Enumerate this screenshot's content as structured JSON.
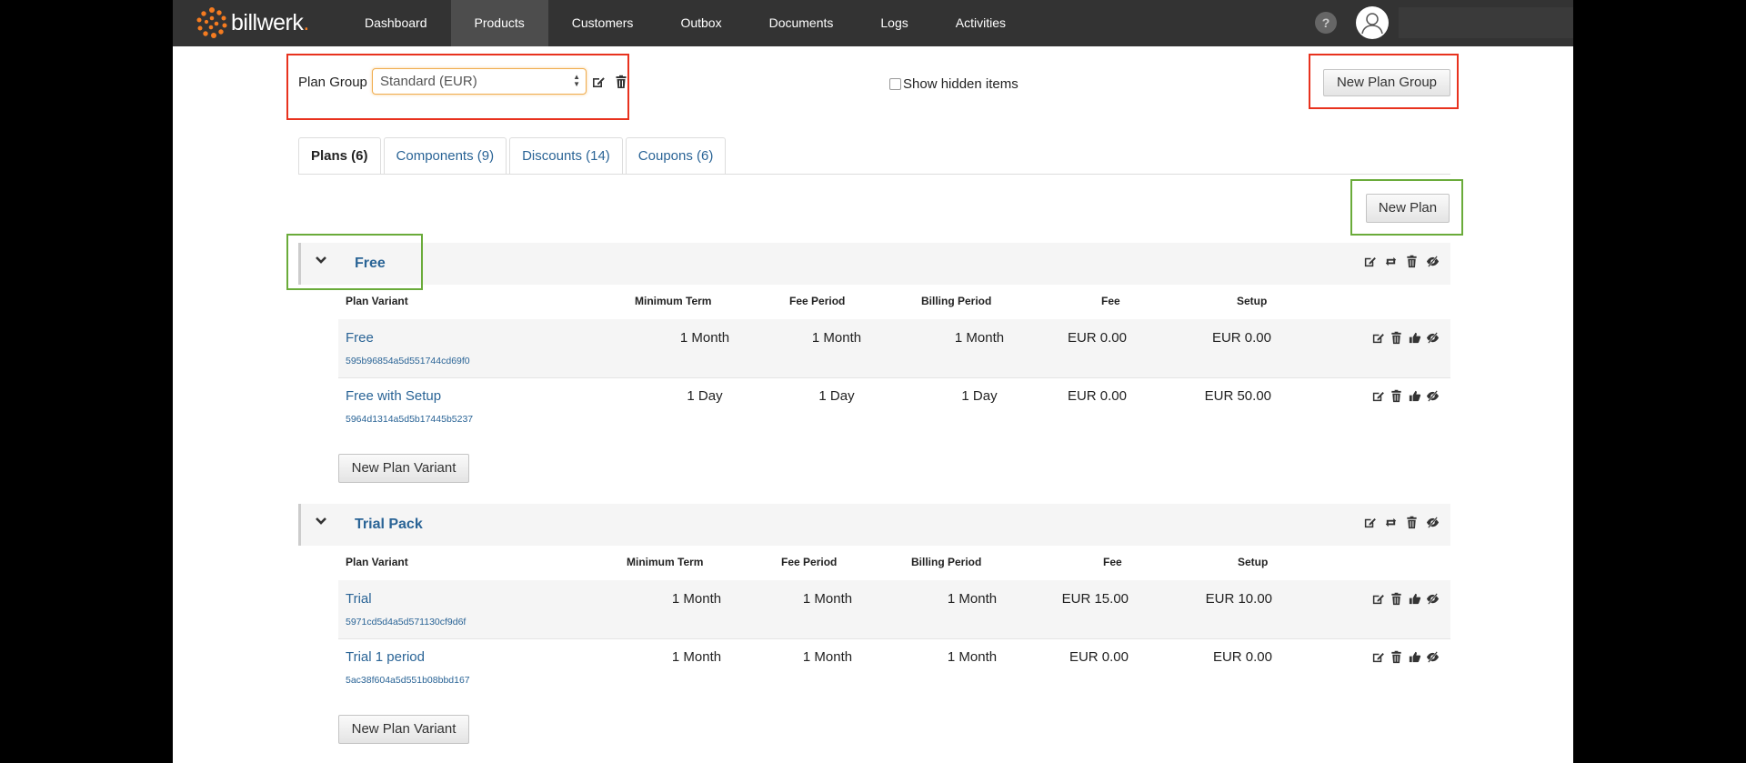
{
  "nav": {
    "brand": "billwerk",
    "brand_dot": ".",
    "items": [
      "Dashboard",
      "Products",
      "Customers",
      "Outbox",
      "Documents",
      "Logs",
      "Activities"
    ],
    "active": "Products",
    "help": "?"
  },
  "plan_group": {
    "label": "Plan Group",
    "selected": "Standard (EUR)",
    "show_hidden_label": "Show hidden items",
    "new_group_button": "New Plan Group"
  },
  "tabs": [
    {
      "label": "Plans (6)",
      "active": true
    },
    {
      "label": "Components (9)",
      "active": false
    },
    {
      "label": "Discounts (14)",
      "active": false
    },
    {
      "label": "Coupons (6)",
      "active": false
    }
  ],
  "new_plan_button": "New Plan",
  "columns": {
    "variant": "Plan Variant",
    "min_term": "Minimum Term",
    "fee_period": "Fee Period",
    "billing_period": "Billing Period",
    "fee": "Fee",
    "setup": "Setup"
  },
  "new_variant_button": "New Plan Variant",
  "groups": [
    {
      "title": "Free",
      "variants": [
        {
          "name": "Free",
          "id": "595b96854a5d551744cd69f0",
          "min_term": "1 Month",
          "fee_period": "1 Month",
          "billing_period": "1 Month",
          "fee": "EUR 0.00",
          "setup": "EUR 0.00"
        },
        {
          "name": "Free with Setup",
          "id": "5964d1314a5d5b17445b5237",
          "min_term": "1 Day",
          "fee_period": "1 Day",
          "billing_period": "1 Day",
          "fee": "EUR 0.00",
          "setup": "EUR 50.00"
        }
      ]
    },
    {
      "title": "Trial Pack",
      "variants": [
        {
          "name": "Trial",
          "id": "5971cd5d4a5d571130cf9d6f",
          "min_term": "1 Month",
          "fee_period": "1 Month",
          "billing_period": "1 Month",
          "fee": "EUR 15.00",
          "setup": "EUR 10.00"
        },
        {
          "name": "Trial 1 period",
          "id": "5ac38f604a5d551b08bbd167",
          "min_term": "1 Month",
          "fee_period": "1 Month",
          "billing_period": "1 Month",
          "fee": "EUR 0.00",
          "setup": "EUR 0.00"
        }
      ]
    }
  ],
  "colors": {
    "nav_bg": "#333333",
    "link": "#2a6496",
    "brand_orange": "#f47b20",
    "highlight_red": "#e8321e",
    "highlight_green": "#6aab3a"
  }
}
